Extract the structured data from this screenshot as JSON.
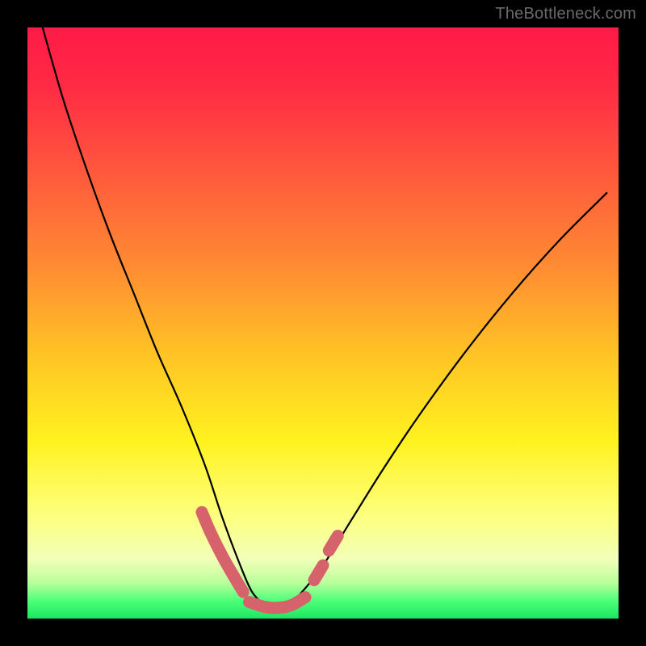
{
  "watermark": {
    "text": "TheBottleneck.com"
  },
  "chart_data": {
    "type": "line",
    "title": "",
    "xlabel": "",
    "ylabel": "",
    "xlim": [
      0,
      100
    ],
    "ylim": [
      0,
      100
    ],
    "series": [
      {
        "name": "bottleneck-curve",
        "x": [
          2,
          6,
          10,
          14,
          18,
          22,
          26,
          30,
          33,
          36,
          38,
          40,
          42,
          44,
          46,
          50,
          55,
          60,
          66,
          74,
          82,
          90,
          98
        ],
        "values": [
          102,
          88,
          76,
          65,
          55,
          45,
          36,
          26,
          17,
          9,
          4.5,
          2.5,
          2,
          2.5,
          4,
          9,
          17,
          25,
          34,
          45,
          55,
          64,
          72
        ]
      }
    ],
    "highlight_segments": [
      {
        "x": [
          29.5,
          31,
          33,
          35,
          36.5
        ],
        "values": [
          18,
          14.5,
          10.5,
          7,
          4.5
        ]
      },
      {
        "x": [
          37.5,
          40,
          42,
          44.5,
          47
        ],
        "values": [
          2.8,
          2.0,
          1.8,
          2.2,
          3.6
        ]
      },
      {
        "x": [
          48.5,
          50
        ],
        "values": [
          6.5,
          9
        ]
      },
      {
        "x": [
          51,
          52.5
        ],
        "values": [
          11.5,
          14
        ]
      }
    ]
  }
}
